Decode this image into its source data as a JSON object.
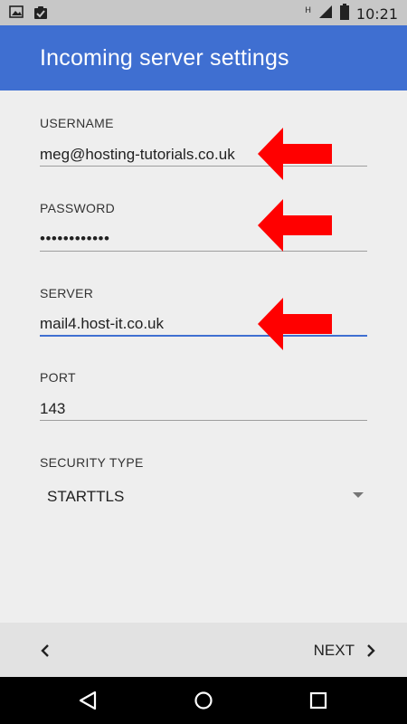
{
  "status_bar": {
    "time": "10:21",
    "network_label": "H",
    "left_icons": [
      "image-icon",
      "clipboard-check-icon"
    ],
    "right_icons": [
      "signal-icon",
      "battery-icon"
    ]
  },
  "app_bar": {
    "title": "Incoming server settings",
    "color": "#3f6fd1"
  },
  "form": {
    "username": {
      "label": "USERNAME",
      "value": "meg@hosting-tutorials.co.uk"
    },
    "password": {
      "label": "PASSWORD",
      "value": "••••••••••••"
    },
    "server": {
      "label": "SERVER",
      "value": "mail4.host-it.co.uk"
    },
    "port": {
      "label": "PORT",
      "value": "143"
    },
    "security_type": {
      "label": "SECURITY TYPE",
      "value": "STARTTLS"
    }
  },
  "annotations": {
    "arrow_color": "#ff0000",
    "arrows": [
      "username-arrow",
      "password-arrow",
      "server-arrow"
    ]
  },
  "bottom_bar": {
    "next_label": "NEXT"
  },
  "nav_bar": {
    "icons": [
      "back-triangle-icon",
      "home-circle-icon",
      "recents-square-icon"
    ]
  }
}
